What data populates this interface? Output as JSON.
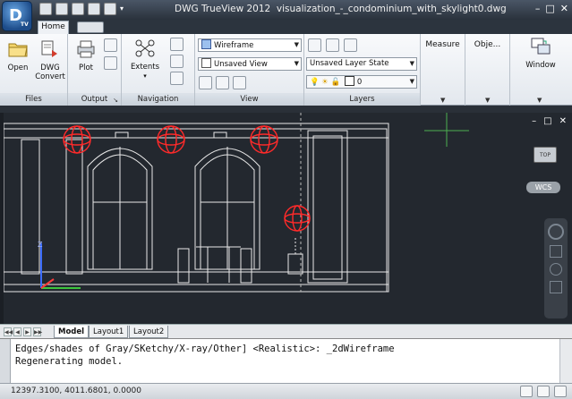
{
  "app": {
    "logo_letter": "D",
    "logo_badge": "TV"
  },
  "title": {
    "app_name": "DWG TrueView 2012",
    "file_name": "visualization_-_condominium_with_skylight0.dwg"
  },
  "window_controls": {
    "minimize": "–",
    "restore": "□",
    "close": "✕"
  },
  "ribbon_tabs": {
    "home": "Home"
  },
  "ribbon": {
    "files": {
      "title": "Files",
      "open": "Open",
      "dwg_convert_1": "DWG",
      "dwg_convert_2": "Convert"
    },
    "output": {
      "title": "Output",
      "plot": "Plot"
    },
    "navigation": {
      "title": "Navigation",
      "extents": "Extents"
    },
    "view": {
      "title": "View",
      "visual_style": "Wireframe",
      "named_view": "Unsaved View"
    },
    "layers": {
      "title": "Layers",
      "layer_state": "Unsaved Layer State",
      "current_layer": "0"
    },
    "measure": {
      "title": "Measure"
    },
    "objects": {
      "title": "Obje..."
    },
    "window": {
      "title": "Window"
    }
  },
  "viewport": {
    "viewcube_face": "TOP",
    "wcs_label": "WCS",
    "win_controls": [
      "–",
      "□",
      "✕"
    ]
  },
  "layout_tabs": {
    "model": "Model",
    "layout1": "Layout1",
    "layout2": "Layout2"
  },
  "command_line": {
    "history_1": "Edges/shades of Gray/SKetchy/X-ray/Other] <Realistic>: _2dWireframe",
    "history_2": "Regenerating model."
  },
  "status_bar": {
    "coordinates": "12397.3100, 4011.6801, 0.0000"
  },
  "colors": {
    "accent": "#1d4c8a",
    "viewport_bg": "#23282f",
    "wire": "#ffffff",
    "light_glyph": "#ff2a2a"
  }
}
